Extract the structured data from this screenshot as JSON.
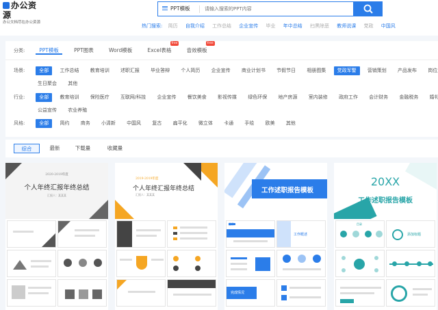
{
  "logo": {
    "name": "办公资源",
    "slogan": "办公文档尽在办公资源"
  },
  "search": {
    "type_label": "PPT模板",
    "placeholder": "请输入搜索的PPT内容"
  },
  "hot": {
    "label": "热门搜索:",
    "items": [
      "简历",
      "自我介绍",
      "工作总结",
      "企业宣传",
      "毕业",
      "年中总结",
      "扫黑除恶",
      "教师说课",
      "党政",
      "中国风"
    ]
  },
  "filter": {
    "category_label": "分类:",
    "categories": [
      "PPT模板",
      "PPT图表",
      "Word模板",
      "Excel表格",
      "音效模板"
    ],
    "badges": {
      "excel": "free",
      "audio": "free"
    },
    "scene_label": "场景:",
    "scenes": [
      "全部",
      "工作总结",
      "教育培训",
      "述职汇报",
      "毕业答辩",
      "个人简历",
      "企业宣传",
      "商业计划书",
      "节假节日",
      "相册图集",
      "党政军警",
      "营销策划",
      "产品发布",
      "岗位竞聘",
      "生日聚会",
      "其他"
    ],
    "industry_label": "行业:",
    "industries": [
      "全部",
      "教育培训",
      "保险医疗",
      "互联网/科技",
      "企业宣传",
      "餐饮美食",
      "影视传媒",
      "绿色环保",
      "地产房源",
      "室内装修",
      "政府工作",
      "会计财务",
      "金融税务",
      "婚礼策划",
      "公益宣传",
      "农业养殖"
    ],
    "style_label": "风格:",
    "styles": [
      "全部",
      "简约",
      "商务",
      "小清新",
      "中国风",
      "复古",
      "扁平化",
      "微立体",
      "卡通",
      "手绘",
      "欧美",
      "其他"
    ]
  },
  "sort": {
    "items": [
      "综合",
      "最新",
      "下载量",
      "收藏量"
    ]
  },
  "cards": [
    {
      "title": "个人年终汇报年终总结",
      "year": "2020-2019年度",
      "sub": "汇报人：某某某"
    },
    {
      "title": "个人年终汇报年终总结",
      "year": "2019-2019年度",
      "sub": "汇报人：某某某"
    },
    {
      "title": "工作述职报告模板",
      "s1": "目录",
      "s2": "工作概述",
      "s3": "完成情况"
    },
    {
      "title": "工作述职报告模板",
      "year": "20XX",
      "s1": "目录",
      "s2": "添加标题"
    }
  ],
  "colors": {
    "accent": "#2b7de9",
    "orange": "#f5a623",
    "teal": "#28a5a8",
    "badge": "#f24a3a"
  }
}
